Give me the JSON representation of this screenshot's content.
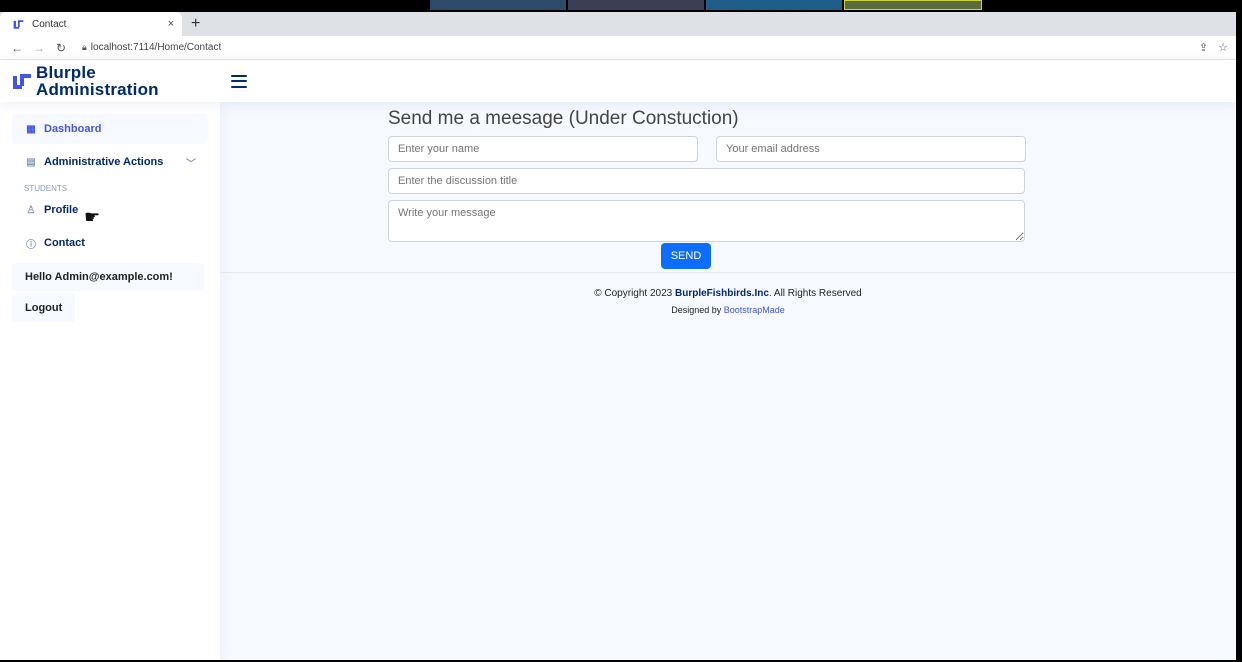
{
  "browser": {
    "tab_title": "Contact",
    "new_tab": "+",
    "close": "×",
    "url": "localhost:7114/Home/Contact"
  },
  "app": {
    "brand_line1": "Blurple",
    "brand_line2": "Administration"
  },
  "sidebar": {
    "items": [
      {
        "label": "Dashboard"
      },
      {
        "label": "Administrative Actions"
      }
    ],
    "heading": "STUDENTS",
    "students": [
      {
        "label": "Profile"
      },
      {
        "label": "Contact"
      }
    ],
    "hello": "Hello Admin@example.com!",
    "logout": "Logout"
  },
  "form": {
    "title": "Send me a meesage (Under Constuction)",
    "name_placeholder": "Enter your name",
    "email_placeholder": "Your email address",
    "title_placeholder": "Enter the discussion title",
    "message_placeholder": "Write your message",
    "send_label": "SEND"
  },
  "footer": {
    "copyright_prefix": "© Copyright 2023 ",
    "company": "BurpleFishbirds.Inc",
    "copyright_suffix": ". All Rights Reserved",
    "designed_by": "Designed by ",
    "designer": "BootstrapMade"
  },
  "colors": {
    "brand": "#012970",
    "accent": "#4154f1",
    "button": "#0d6efd"
  }
}
